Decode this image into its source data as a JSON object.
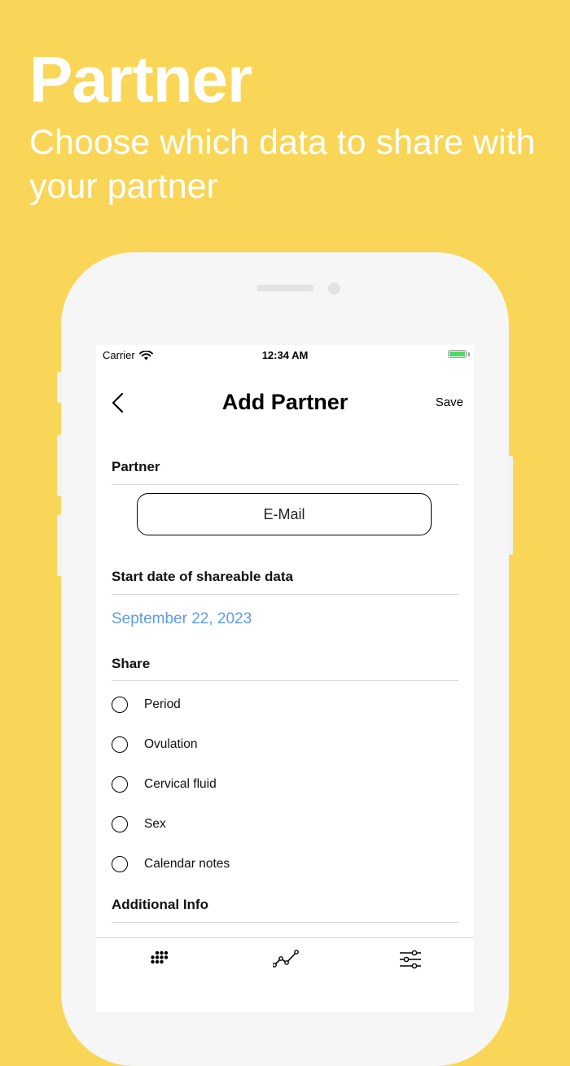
{
  "hero": {
    "title": "Partner",
    "subtitle": "Choose which data to share with your partner"
  },
  "status_bar": {
    "carrier": "Carrier",
    "time": "12:34 AM"
  },
  "nav": {
    "title": "Add Partner",
    "save_label": "Save"
  },
  "partner_section": {
    "label": "Partner",
    "email_placeholder": "E-Mail"
  },
  "start_date_section": {
    "label": "Start date of shareable data",
    "date": "September 22, 2023"
  },
  "share_section": {
    "label": "Share",
    "options": [
      {
        "label": "Period",
        "checked": false
      },
      {
        "label": "Ovulation",
        "checked": false
      },
      {
        "label": "Cervical fluid",
        "checked": false
      },
      {
        "label": "Sex",
        "checked": false
      },
      {
        "label": "Calendar notes",
        "checked": false
      }
    ]
  },
  "additional_section": {
    "label": "Additional Info"
  },
  "tabbar": {
    "tabs": [
      "calendar-dots-icon",
      "chart-line-icon",
      "sliders-icon"
    ]
  },
  "colors": {
    "background": "#F9D658",
    "accent_link": "#5B9BE8",
    "battery": "#4CD964"
  }
}
